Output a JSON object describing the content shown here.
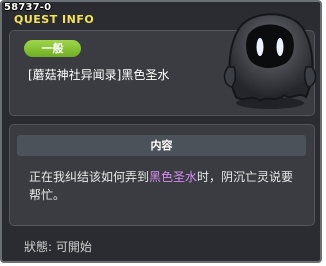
{
  "window": {
    "quest_id": "58737-0",
    "title": "QUEST INFO"
  },
  "quest": {
    "category": "一般",
    "name": "[蘑菇神社异闻录]黑色圣水"
  },
  "content": {
    "header": "内容",
    "description_before": "正在我纠结该如何弄到",
    "description_highlight": "黑色圣水",
    "description_after": "时，阴沉亡灵说要帮忙。"
  },
  "status": {
    "text": "狀態:  可開始"
  },
  "icons": {
    "npc": "gloomy-ghost-npc-icon"
  }
}
